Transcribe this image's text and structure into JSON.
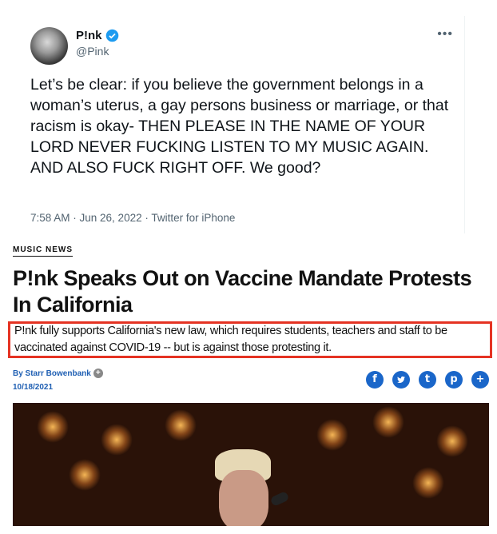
{
  "tweet": {
    "name": "P!nk",
    "handle": "@Pink",
    "more_label": "•••",
    "text": "Let’s be clear: if you believe the government belongs in a woman’s uterus, a gay persons business or marriage, or that racism is okay- THEN PLEASE IN THE NAME OF YOUR LORD NEVER FUCKING LISTEN TO MY MUSIC AGAIN. AND ALSO FUCK RIGHT OFF. We good?",
    "meta": "7:58 AM · Jun 26, 2022 · Twitter for iPhone"
  },
  "article": {
    "section": "MUSIC NEWS",
    "headline": "P!nk Speaks Out on Vaccine Mandate Protests In California",
    "dek": "P!nk fully supports California's new law, which requires students, teachers and staff to be vaccinated against COVID-19 -- but is against those protesting it.",
    "byline": "By Starr Bowenbank",
    "date": "10/18/2021",
    "share_icons": [
      "f",
      "t-bird",
      "t",
      "p",
      "+"
    ],
    "highlight_color": "#e53323",
    "link_color": "#1f5fb3"
  }
}
